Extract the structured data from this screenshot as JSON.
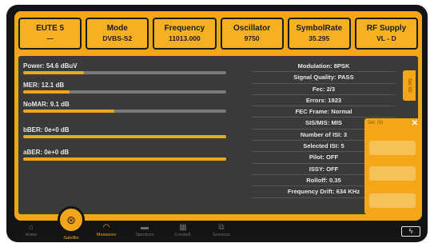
{
  "header": [
    {
      "label": "EUTE 5",
      "value": "—"
    },
    {
      "label": "Mode",
      "value": "DVBS-S2"
    },
    {
      "label": "Frequency",
      "value": "11013.000"
    },
    {
      "label": "Oscillator",
      "value": "9750"
    },
    {
      "label": "SymbolRate",
      "value": "35.295"
    },
    {
      "label": "RF Supply",
      "value": "VL - D"
    }
  ],
  "meters": [
    {
      "label": "Power: 54.6 dBuV",
      "fill_pct": 30
    },
    {
      "label": "MER: 12.1 dB",
      "fill_pct": 23
    },
    {
      "label": "NoMAR: 9.1 dB",
      "fill_pct": 45
    },
    {
      "label": "bBER: 0e+0 dB",
      "fill_pct": 100
    },
    {
      "label": "aBER: 0e+0 dB",
      "fill_pct": 100
    }
  ],
  "info": [
    "Modulation: 8PSK",
    "Signal Quality: PASS",
    "Fec: 2/3",
    "Errors: 1923",
    "FEC Frame: Normal",
    "SIS/MIS: MIS",
    "Number of ISI: 3",
    "Selected ISI: 5",
    "Pilot: OFF",
    "ISSY: OFF",
    "Rolloff: 0.35",
    "Frequency Drift: 634 KHz"
  ],
  "side_tab": "Sel ISI",
  "popup": {
    "title": "Sel. ISI",
    "close": "✕"
  },
  "nav": {
    "items": [
      "Home",
      "Satellite",
      "Measures",
      "Spectrum",
      "Constell.",
      "Sessions"
    ],
    "active": "Measures"
  },
  "colors": {
    "accent": "#f3a718",
    "panel": "#3a3a3a",
    "bezel": "#141414"
  }
}
